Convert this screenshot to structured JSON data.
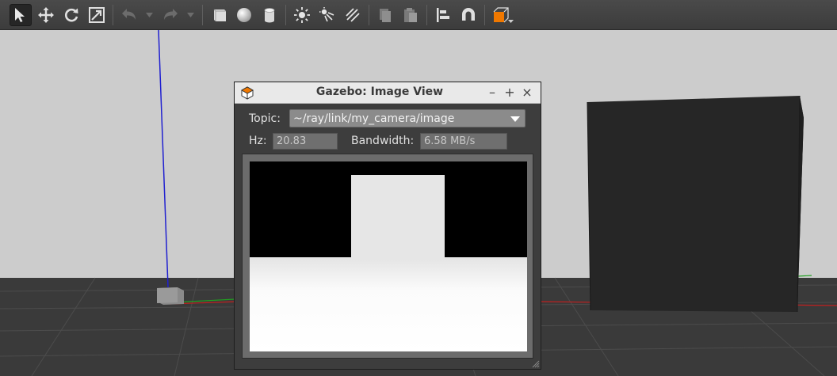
{
  "toolbar": {
    "tools": [
      {
        "icon": "select-arrow-icon",
        "active": true
      },
      {
        "icon": "translate-icon"
      },
      {
        "icon": "rotate-icon"
      },
      {
        "icon": "scale-icon"
      },
      {
        "icon": "undo-icon"
      },
      {
        "icon": "redo-icon"
      },
      {
        "icon": "box-shape-icon"
      },
      {
        "icon": "sphere-shape-icon"
      },
      {
        "icon": "cylinder-shape-icon"
      },
      {
        "icon": "point-light-icon"
      },
      {
        "icon": "spot-light-icon"
      },
      {
        "icon": "directional-light-icon"
      },
      {
        "icon": "copy-icon"
      },
      {
        "icon": "paste-icon"
      },
      {
        "icon": "align-icon"
      },
      {
        "icon": "snap-magnet-icon"
      },
      {
        "icon": "view-angle-icon"
      }
    ],
    "accent_color": "#f07800"
  },
  "dialog": {
    "title": "Gazebo: Image View",
    "window_buttons": {
      "minimize": "–",
      "maximize": "+",
      "close": "×"
    },
    "topic": {
      "label": "Topic:",
      "value": "~/ray/link/my_camera/image"
    },
    "hz": {
      "label": "Hz:",
      "value": "20.83"
    },
    "bandwidth": {
      "label": "Bandwidth:",
      "value": "6.58 MB/s"
    }
  },
  "scene": {
    "sky_color": "#cccccc",
    "ground_color": "#3a3a3a",
    "z_axis_color": "#2020d0",
    "x_axis_color": "#c02020",
    "y_axis_color": "#20a020",
    "box_color": "#262626"
  }
}
